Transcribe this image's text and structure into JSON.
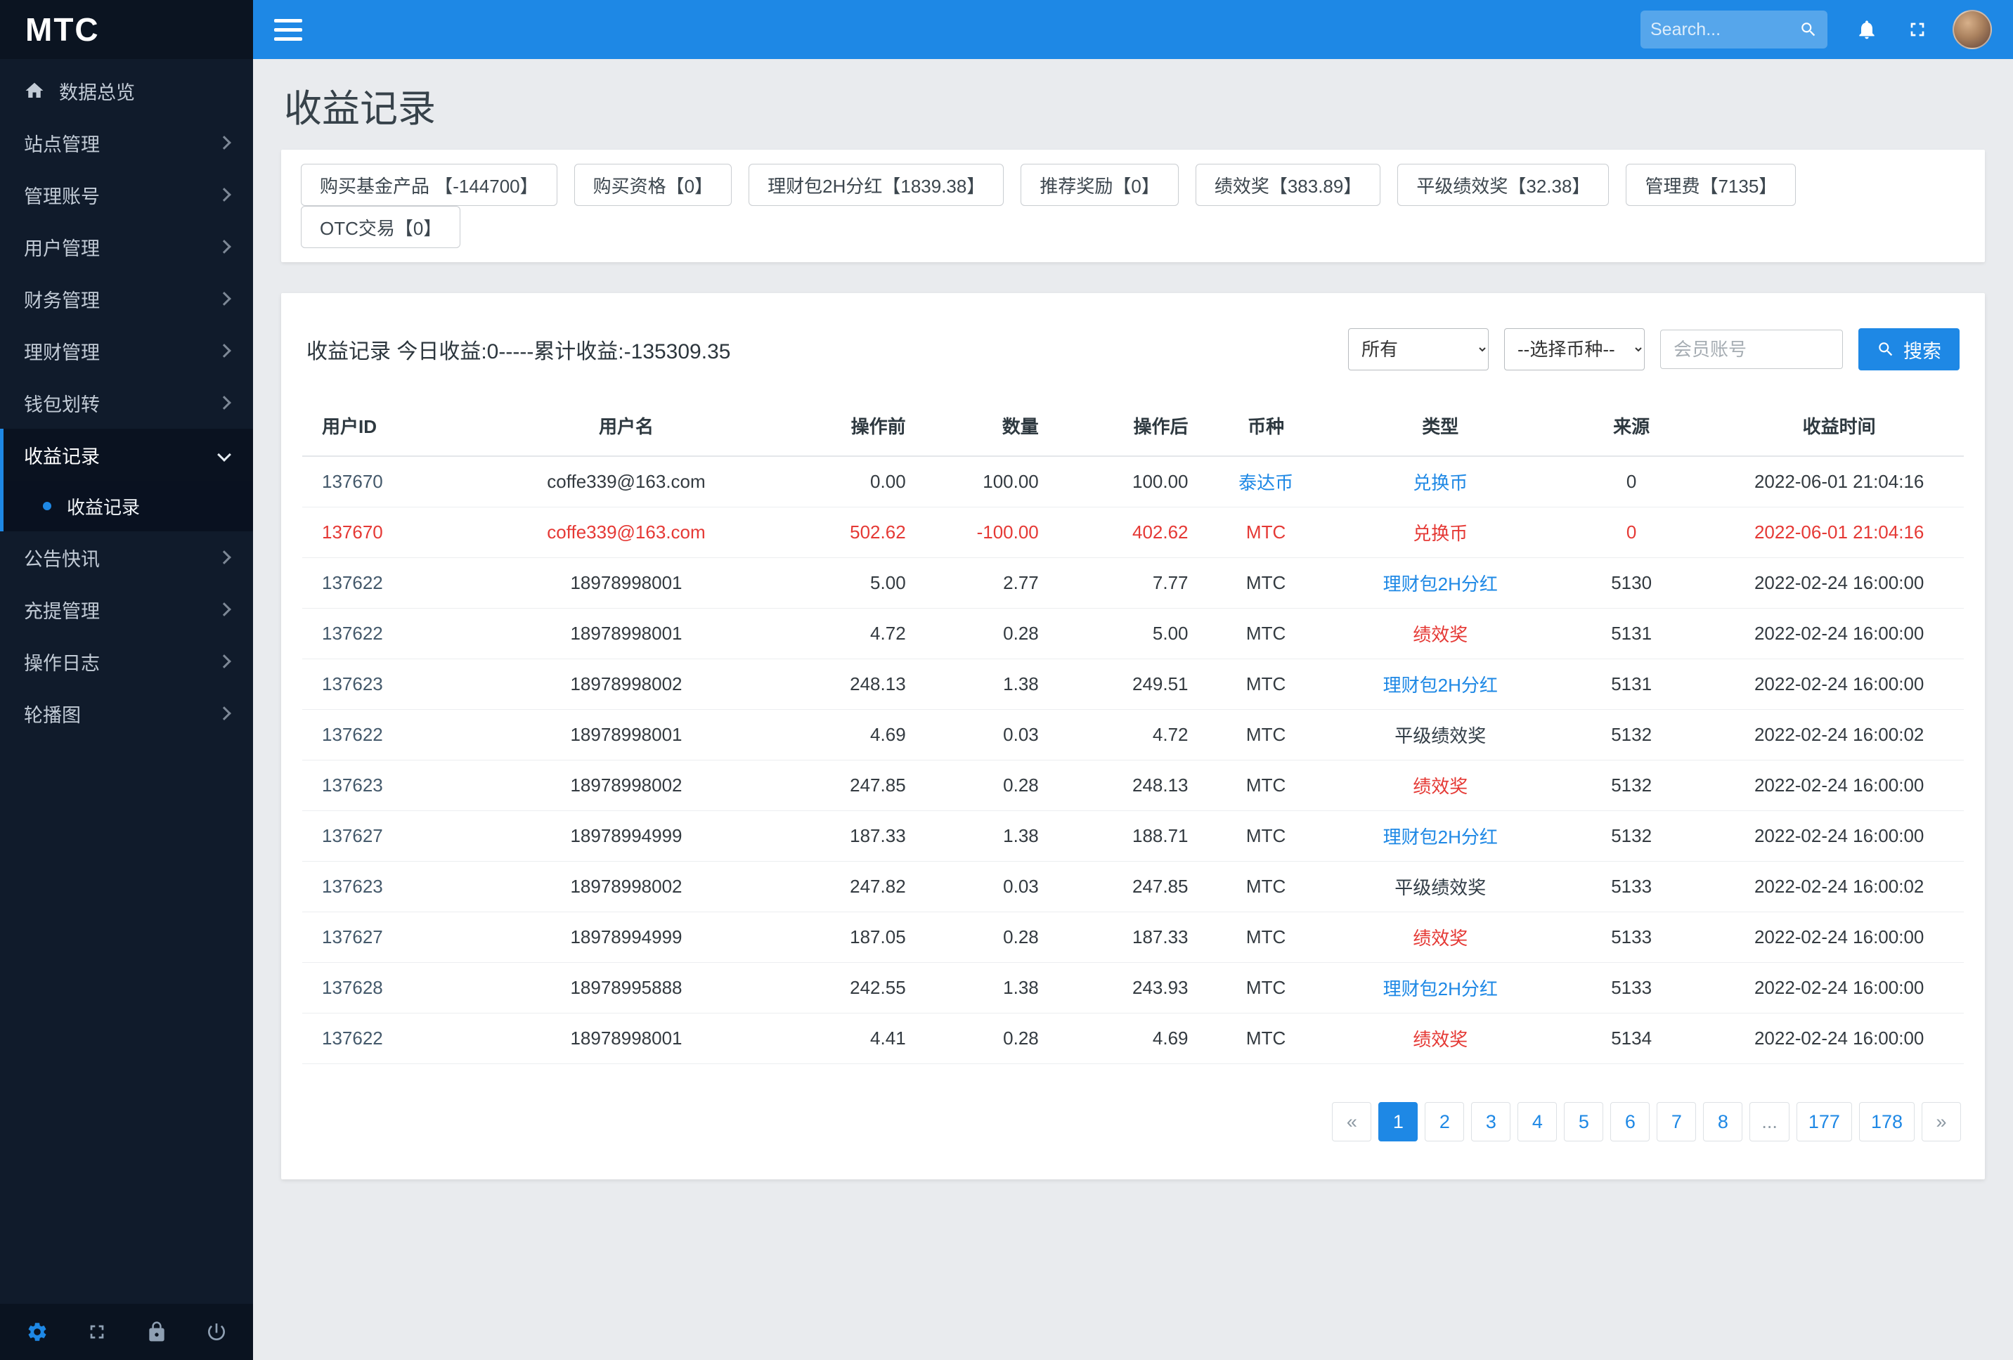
{
  "brand": {
    "logo_text": "MTC"
  },
  "topbar": {
    "search_placeholder": "Search..."
  },
  "sidebar": {
    "items": [
      {
        "label": "数据总览",
        "icon": "home",
        "arrow": false,
        "key": "dashboard"
      },
      {
        "label": "站点管理",
        "arrow": true,
        "key": "site"
      },
      {
        "label": "管理账号",
        "arrow": true,
        "key": "admin-account"
      },
      {
        "label": "用户管理",
        "arrow": true,
        "key": "users"
      },
      {
        "label": "财务管理",
        "arrow": true,
        "key": "finance"
      },
      {
        "label": "理财管理",
        "arrow": true,
        "key": "wealth"
      },
      {
        "label": "钱包划转",
        "arrow": true,
        "key": "wallet-transfer"
      },
      {
        "label": "收益记录",
        "arrow": true,
        "expanded": true,
        "active": true,
        "key": "income",
        "children": [
          {
            "label": "收益记录",
            "active": true,
            "key": "income-records"
          }
        ]
      },
      {
        "label": "公告快讯",
        "arrow": true,
        "key": "announcements"
      },
      {
        "label": "充提管理",
        "arrow": true,
        "key": "deposit-withdraw"
      },
      {
        "label": "操作日志",
        "arrow": true,
        "key": "operation-logs"
      },
      {
        "label": "轮播图",
        "arrow": true,
        "key": "carousel"
      }
    ]
  },
  "page": {
    "title": "收益记录",
    "stat_buttons": [
      "购买基金产品 【-144700】",
      "购买资格【0】",
      "理财包2H分红【1839.38】",
      "推荐奖励【0】",
      "绩效奖【383.89】",
      "平级绩效奖【32.38】",
      "管理费【7135】",
      "OTC交易【0】"
    ],
    "summary": "收益记录 今日收益:0-----累计收益:-135309.35",
    "filters": {
      "type_select_value": "所有",
      "coin_select_value": "--选择币种--",
      "account_placeholder": "会员账号",
      "search_button_label": "搜索"
    }
  },
  "table": {
    "headers": [
      "用户ID",
      "用户名",
      "操作前",
      "数量",
      "操作后",
      "币种",
      "类型",
      "来源",
      "收益时间"
    ],
    "rows": [
      {
        "id": "137670",
        "name": "coffe339@163.com",
        "before": "0.00",
        "qty": "100.00",
        "after": "100.00",
        "coin": "泰达币",
        "coin_color": "blue",
        "type": "兑换币",
        "type_color": "blue",
        "source": "0",
        "time": "2022-06-01 21:04:16",
        "row_color": ""
      },
      {
        "id": "137670",
        "name": "coffe339@163.com",
        "before": "502.62",
        "qty": "-100.00",
        "after": "402.62",
        "coin": "MTC",
        "coin_color": "",
        "type": "兑换币",
        "type_color": "",
        "source": "0",
        "time": "2022-06-01 21:04:16",
        "row_color": "red"
      },
      {
        "id": "137622",
        "name": "18978998001",
        "before": "5.00",
        "qty": "2.77",
        "after": "7.77",
        "coin": "MTC",
        "coin_color": "",
        "type": "理财包2H分红",
        "type_color": "blue",
        "source": "5130",
        "time": "2022-02-24 16:00:00",
        "row_color": ""
      },
      {
        "id": "137622",
        "name": "18978998001",
        "before": "4.72",
        "qty": "0.28",
        "after": "5.00",
        "coin": "MTC",
        "coin_color": "",
        "type": "绩效奖",
        "type_color": "red",
        "source": "5131",
        "time": "2022-02-24 16:00:00",
        "row_color": ""
      },
      {
        "id": "137623",
        "name": "18978998002",
        "before": "248.13",
        "qty": "1.38",
        "after": "249.51",
        "coin": "MTC",
        "coin_color": "",
        "type": "理财包2H分红",
        "type_color": "blue",
        "source": "5131",
        "time": "2022-02-24 16:00:00",
        "row_color": ""
      },
      {
        "id": "137622",
        "name": "18978998001",
        "before": "4.69",
        "qty": "0.03",
        "after": "4.72",
        "coin": "MTC",
        "coin_color": "",
        "type": "平级绩效奖",
        "type_color": "dark",
        "source": "5132",
        "time": "2022-02-24 16:00:02",
        "row_color": ""
      },
      {
        "id": "137623",
        "name": "18978998002",
        "before": "247.85",
        "qty": "0.28",
        "after": "248.13",
        "coin": "MTC",
        "coin_color": "",
        "type": "绩效奖",
        "type_color": "red",
        "source": "5132",
        "time": "2022-02-24 16:00:00",
        "row_color": ""
      },
      {
        "id": "137627",
        "name": "18978994999",
        "before": "187.33",
        "qty": "1.38",
        "after": "188.71",
        "coin": "MTC",
        "coin_color": "",
        "type": "理财包2H分红",
        "type_color": "blue",
        "source": "5132",
        "time": "2022-02-24 16:00:00",
        "row_color": ""
      },
      {
        "id": "137623",
        "name": "18978998002",
        "before": "247.82",
        "qty": "0.03",
        "after": "247.85",
        "coin": "MTC",
        "coin_color": "",
        "type": "平级绩效奖",
        "type_color": "dark",
        "source": "5133",
        "time": "2022-02-24 16:00:02",
        "row_color": ""
      },
      {
        "id": "137627",
        "name": "18978994999",
        "before": "187.05",
        "qty": "0.28",
        "after": "187.33",
        "coin": "MTC",
        "coin_color": "",
        "type": "绩效奖",
        "type_color": "red",
        "source": "5133",
        "time": "2022-02-24 16:00:00",
        "row_color": ""
      },
      {
        "id": "137628",
        "name": "18978995888",
        "before": "242.55",
        "qty": "1.38",
        "after": "243.93",
        "coin": "MTC",
        "coin_color": "",
        "type": "理财包2H分红",
        "type_color": "blue",
        "source": "5133",
        "time": "2022-02-24 16:00:00",
        "row_color": ""
      },
      {
        "id": "137622",
        "name": "18978998001",
        "before": "4.41",
        "qty": "0.28",
        "after": "4.69",
        "coin": "MTC",
        "coin_color": "",
        "type": "绩效奖",
        "type_color": "red",
        "source": "5134",
        "time": "2022-02-24 16:00:00",
        "row_color": ""
      }
    ]
  },
  "pagination": {
    "items": [
      "«",
      "1",
      "2",
      "3",
      "4",
      "5",
      "6",
      "7",
      "8",
      "...",
      "177",
      "178",
      "»"
    ],
    "active": "1"
  },
  "colors": {
    "accent": "#1e88e5",
    "danger": "#e53935",
    "sidebar_bg": "#101b2b",
    "topbar_bg": "#1e88e5"
  }
}
